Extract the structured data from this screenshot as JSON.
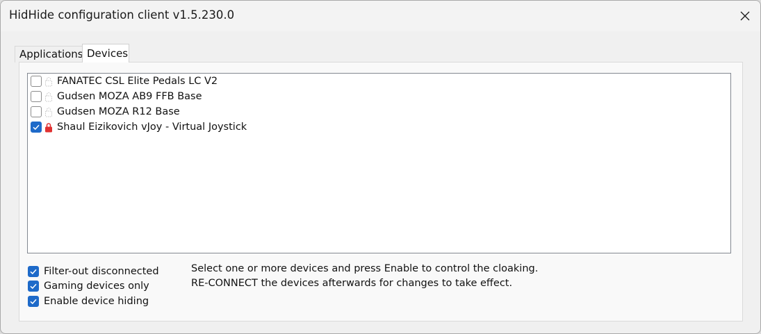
{
  "window": {
    "title": "HidHide configuration client v1.5.230.0",
    "close_icon": "close-icon"
  },
  "tabs": [
    {
      "label": "Applications",
      "selected": false
    },
    {
      "label": "Devices",
      "selected": true
    }
  ],
  "devices": [
    {
      "label": "FANATEC CSL Elite Pedals LC V2",
      "checked": false,
      "icon": "device-unhidden-icon"
    },
    {
      "label": "Gudsen MOZA AB9 FFB Base",
      "checked": false,
      "icon": "device-unhidden-icon"
    },
    {
      "label": "Gudsen MOZA R12 Base",
      "checked": false,
      "icon": "device-unhidden-icon"
    },
    {
      "label": "Shaul Eizikovich vJoy - Virtual Joystick",
      "checked": true,
      "icon": "lock-icon"
    }
  ],
  "options": [
    {
      "label": "Filter-out disconnected",
      "checked": true
    },
    {
      "label": "Gaming devices only",
      "checked": true
    },
    {
      "label": "Enable device hiding",
      "checked": true
    }
  ],
  "help": {
    "line1": "Select one or more devices and press Enable to control the cloaking.",
    "line2": "RE-CONNECT the devices afterwards for changes to take effect."
  },
  "colors": {
    "accent": "#1e6ac9",
    "lock": "#e03131"
  }
}
